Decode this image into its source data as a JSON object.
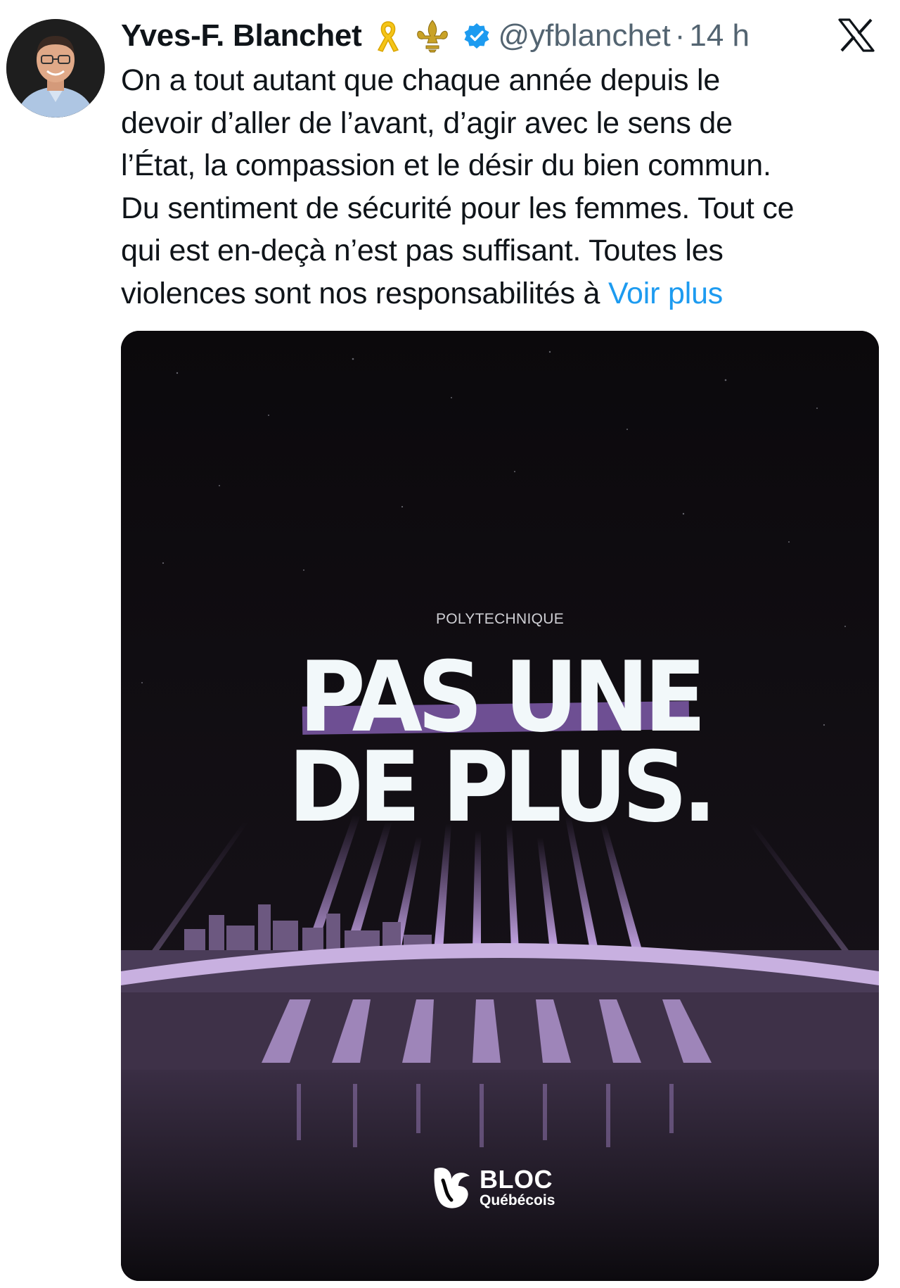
{
  "tweet": {
    "author_name": "Yves-F. Blanchet",
    "handle": "@yfblanchet",
    "separator": "·",
    "time": "14 h",
    "text_lines": [
      "On a tout autant que chaque année depuis le",
      "devoir d’aller de l’avant, d’agir avec le sens de",
      "l’État, la compassion et le désir du bien commun.",
      "Du sentiment de sécurité pour les femmes. Tout ce",
      "qui est en-deçà n’est pas suffisant. Toutes les",
      "violences sont nos responsabilités à "
    ],
    "more_label": "Voir plus",
    "icons": [
      "yellow-ribbon-icon",
      "fleur-de-lis-icon",
      "verified-badge-icon",
      "x-logo-icon"
    ]
  },
  "media": {
    "kicker": "POLYTECHNIQUE",
    "headline_line1": "PAS UNE",
    "headline_line2": "DE PLUS.",
    "logo_line1": "BLOC",
    "logo_line2": "Québécois",
    "accent_color": "#6e4f93",
    "light_color": "#c9a6f0"
  },
  "colors": {
    "link": "#1d9bf0",
    "secondary_text": "#536471",
    "verified": "#1d9bf0"
  }
}
